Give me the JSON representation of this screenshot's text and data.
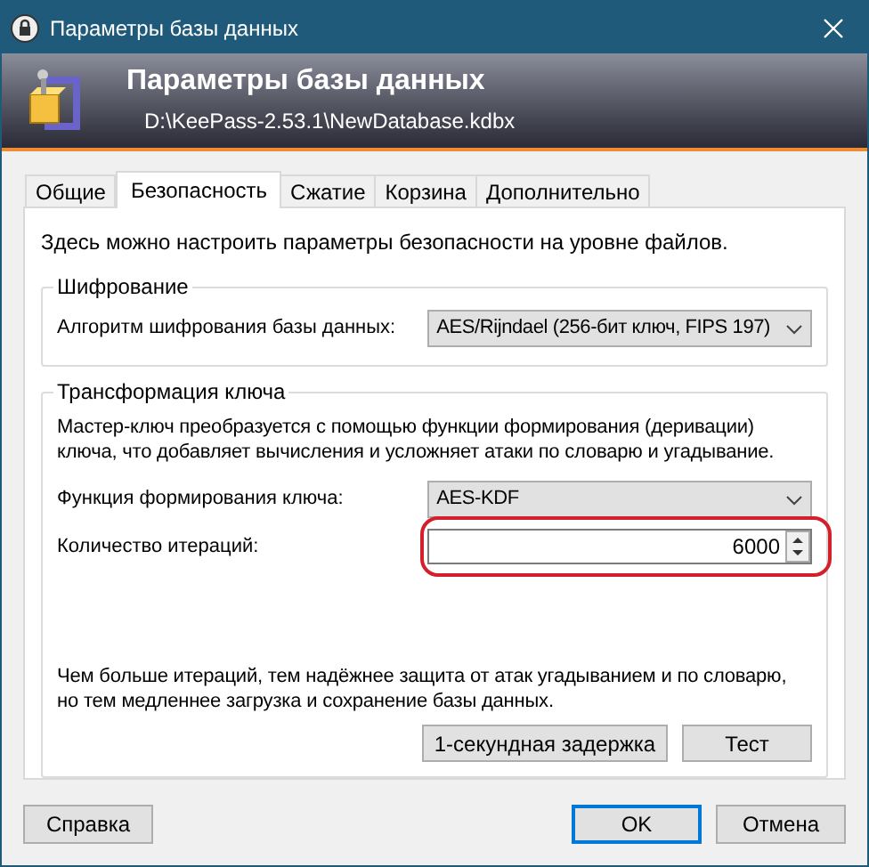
{
  "window": {
    "title": "Параметры базы данных"
  },
  "header": {
    "title": "Параметры базы данных",
    "path": "D:\\KeePass-2.53.1\\NewDatabase.kdbx"
  },
  "tabs": [
    {
      "label": "Общие",
      "selected": false
    },
    {
      "label": "Безопасность",
      "selected": true
    },
    {
      "label": "Сжатие",
      "selected": false
    },
    {
      "label": "Корзина",
      "selected": false
    },
    {
      "label": "Дополнительно",
      "selected": false
    }
  ],
  "intro": "Здесь можно настроить параметры безопасности на уровне файлов.",
  "encryption": {
    "title": "Шифрование",
    "label": "Алгоритм шифрования базы данных:",
    "value": "AES/Rijndael (256-бит ключ, FIPS 197)"
  },
  "key_transform": {
    "title": "Трансформация ключа",
    "description": "Мастер-ключ преобразуется с помощью функции формирования (деривации) ключа, что добавляет вычисления и усложняет атаки по словарю и угадывание.",
    "kdf_label": "Функция формирования ключа:",
    "kdf_value": "AES-KDF",
    "iterations_label": "Количество итераций:",
    "iterations_value": "6000",
    "iterations_highlighted": true,
    "note": "Чем больше итераций, тем надёжнее защита от атак угадыванием и по словарю, но тем медленнее загрузка и сохранение базы данных.",
    "buttons": [
      "1-секундная задержка",
      "Тест"
    ]
  },
  "footer": {
    "help": "Справка",
    "ok": "OK",
    "cancel": "Отмена"
  }
}
